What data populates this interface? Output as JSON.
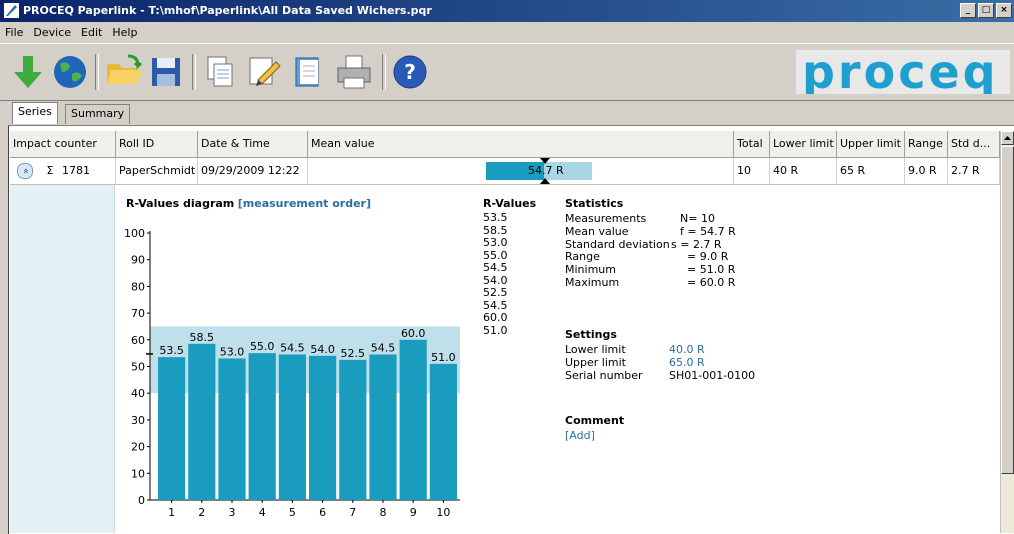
{
  "window": {
    "title": "PROCEQ Paperlink - T:\\mhof\\Paperlink\\All Data Saved Wichers.pqr",
    "controls": [
      "_",
      "□",
      "×"
    ]
  },
  "menu": [
    "File",
    "Device",
    "Edit",
    "Help"
  ],
  "toolbar": {
    "buttons": [
      "download-icon",
      "globe-icon",
      "open-folder-icon",
      "save-icon",
      "copy-icon",
      "edit-icon",
      "notebook-icon",
      "print-icon",
      "help-icon"
    ],
    "logo_text": "proceq"
  },
  "tabs": [
    {
      "label": "Series",
      "active": true
    },
    {
      "label": "Summary",
      "active": false
    }
  ],
  "table": {
    "headers": [
      "Impact counter",
      "Roll ID",
      "Date & Time",
      "Mean value",
      "Total",
      "Lower limit",
      "Upper limit",
      "Range",
      "Std d..."
    ],
    "row": {
      "expand_glyph": "«",
      "sigma": "Σ",
      "impact_counter": "1781",
      "roll_id": "PaperSchmidt",
      "date_time": "09/29/2009 12:22",
      "mean_value": "54.7 R",
      "mean_fraction": 0.547,
      "total": "10",
      "lower_limit": "40 R",
      "upper_limit": "65 R",
      "range": "9.0 R",
      "std_dev": "2.7 R"
    }
  },
  "diagram": {
    "title": "R-Values diagram",
    "link": "[measurement order]"
  },
  "chart_data": {
    "type": "bar",
    "categories": [
      "1",
      "2",
      "3",
      "4",
      "5",
      "6",
      "7",
      "8",
      "9",
      "10"
    ],
    "values": [
      53.5,
      58.5,
      53.0,
      55.0,
      54.5,
      54.0,
      52.5,
      54.5,
      60.0,
      51.0
    ],
    "value_labels": [
      "53.5",
      "58.5",
      "53.0",
      "55.0",
      "54.5",
      "54.0",
      "52.5",
      "54.5",
      "60.0",
      "51.0"
    ],
    "yticks": [
      "0",
      "10",
      "20",
      "30",
      "40",
      "50",
      "60",
      "70",
      "80",
      "90",
      "100"
    ],
    "ylim": [
      0,
      100
    ],
    "lower_limit": 40,
    "upper_limit": 65,
    "mean": 54.7,
    "bar_color": "#1a9cbf",
    "band_color": "#bfe0ea"
  },
  "rvalues": {
    "title": "R-Values",
    "list": [
      "53.5",
      "58.5",
      "53.0",
      "55.0",
      "54.5",
      "54.0",
      "52.5",
      "54.5",
      "60.0",
      "51.0"
    ]
  },
  "statistics": {
    "title": "Statistics",
    "rows": [
      {
        "label": "Measurements",
        "value": "N= 10"
      },
      {
        "label": "Mean value",
        "value": "f = 54.7 R"
      },
      {
        "label": "Standard deviation",
        "value": "s = 2.7 R"
      },
      {
        "label": "Range",
        "value": "= 9.0 R"
      },
      {
        "label": "Minimum",
        "value": "= 51.0 R"
      },
      {
        "label": "Maximum",
        "value": "= 60.0 R"
      }
    ]
  },
  "settings": {
    "title": "Settings",
    "rows": [
      {
        "label": "Lower limit",
        "value": "40.0 R"
      },
      {
        "label": "Upper limit",
        "value": "65.0 R"
      },
      {
        "label": "Serial number",
        "value": "SH01-001-0100"
      }
    ]
  },
  "comment": {
    "title": "Comment",
    "link": "[Add]"
  }
}
